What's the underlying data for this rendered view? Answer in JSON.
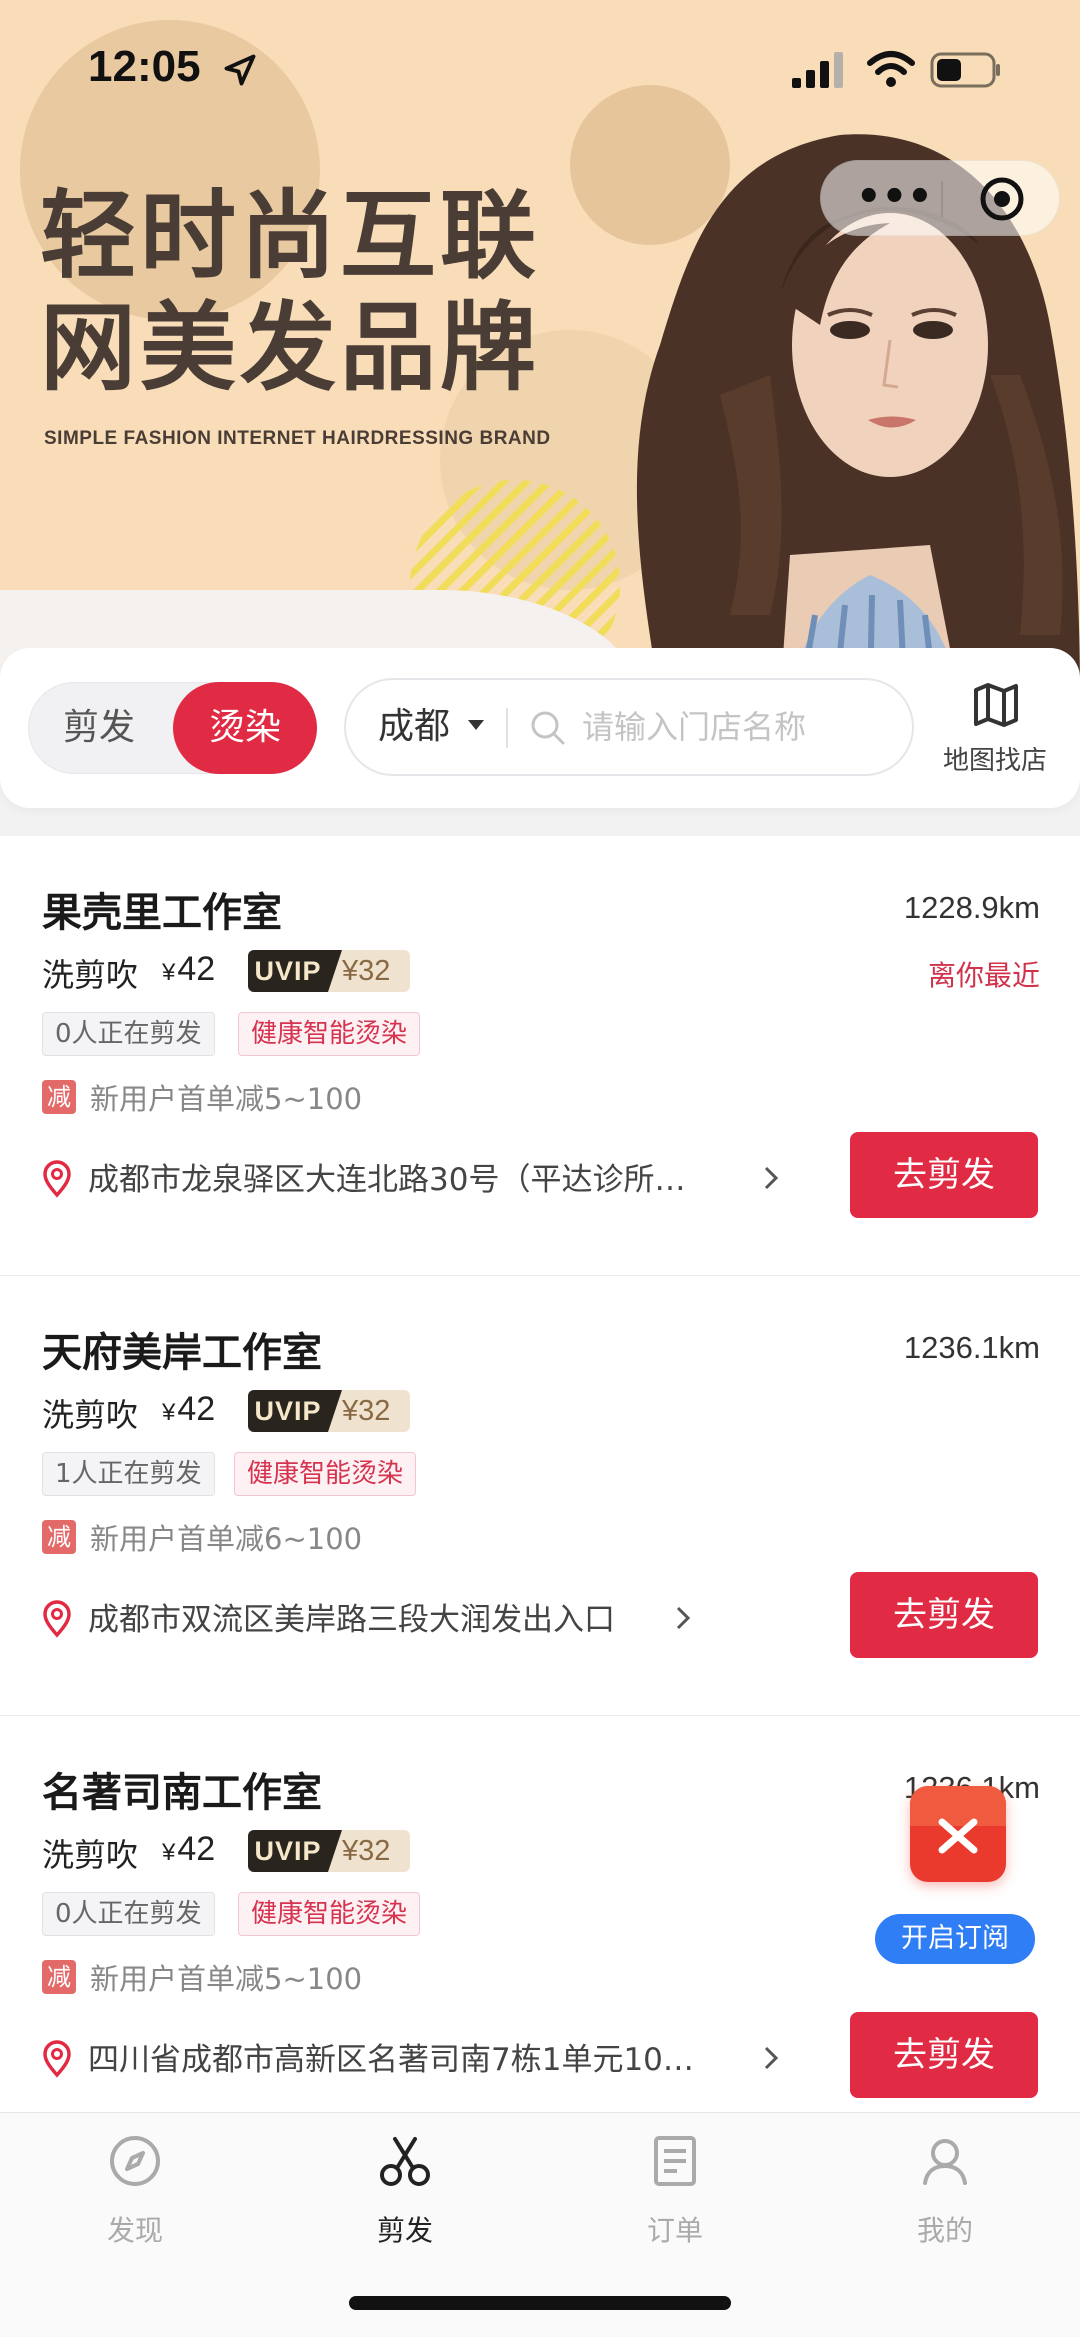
{
  "status_bar": {
    "time": "12:05"
  },
  "banner": {
    "headline_line1": "轻时尚互联",
    "headline_line2": "网美发品牌",
    "subline": "SIMPLE FASHION INTERNET HAIRDRESSING BRAND"
  },
  "capsule": {
    "more_label": "•••"
  },
  "filter": {
    "segments": [
      "剪发",
      "烫染"
    ],
    "active_segment": "烫染",
    "city": "成都",
    "search_placeholder": "请输入门店名称",
    "map_label": "地图找店"
  },
  "stores": [
    {
      "name": "果壳里工作室",
      "distance": "1228.9km",
      "nearest": "离你最近",
      "service": "洗剪吹",
      "yen": "¥",
      "price": "42",
      "vip_tag": "UVIP",
      "vip_price": "¥32",
      "cutting_now": "0人正在剪发",
      "feature": "健康智能烫染",
      "promo_icon": "减",
      "promo": "新用户首单减5~100",
      "address": "成都市龙泉驿区大连北路30号（平达诊所…",
      "button": "去剪发"
    },
    {
      "name": "天府美岸工作室",
      "distance": "1236.1km",
      "nearest": "",
      "service": "洗剪吹",
      "yen": "¥",
      "price": "42",
      "vip_tag": "UVIP",
      "vip_price": "¥32",
      "cutting_now": "1人正在剪发",
      "feature": "健康智能烫染",
      "promo_icon": "减",
      "promo": "新用户首单减6~100",
      "address": "成都市双流区美岸路三段大润发出入口",
      "button": "去剪发"
    },
    {
      "name": "名著司南工作室",
      "distance": "1236.1km",
      "nearest": "",
      "service": "洗剪吹",
      "yen": "¥",
      "price": "42",
      "vip_tag": "UVIP",
      "vip_price": "¥32",
      "cutting_now": "0人正在剪发",
      "feature": "健康智能烫染",
      "promo_icon": "减",
      "promo": "新用户首单减5~100",
      "address": "四川省成都市高新区名著司南7栋1单元10…",
      "button": "去剪发"
    }
  ],
  "subscribe": {
    "label": "开启订阅"
  },
  "tabs": [
    {
      "label": "发现",
      "icon": "compass-icon"
    },
    {
      "label": "剪发",
      "icon": "scissors-icon"
    },
    {
      "label": "订单",
      "icon": "order-icon"
    },
    {
      "label": "我的",
      "icon": "profile-icon"
    }
  ],
  "active_tab": "剪发",
  "colors": {
    "accent": "#e12a43",
    "banner_bg": "#f8ddb8",
    "subscribe_blue": "#2f7ef5"
  }
}
